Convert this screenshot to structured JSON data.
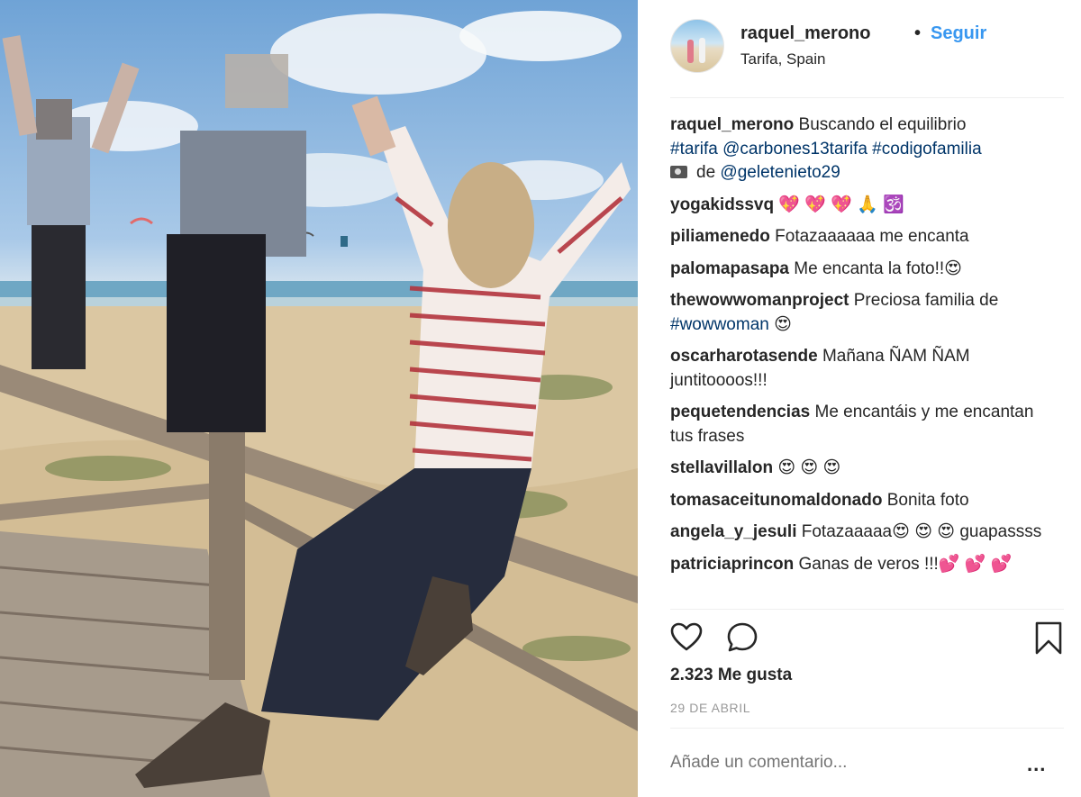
{
  "post": {
    "username": "raquel_merono",
    "separator": "•",
    "follow_label": "Seguir",
    "location": "Tarifa, Spain",
    "caption": {
      "user": "raquel_merono",
      "text_line1": "Buscando el equilibrio",
      "hashtags_line": "#tarifa @carbones13tarifa #codigofamilia",
      "credit_prefix": "de",
      "credit_handle": "@geletenieto29"
    },
    "comments": [
      {
        "user": "yogakidssvq",
        "text": "💖 💖 💖 🙏 🕉️"
      },
      {
        "user": "piliamenedo",
        "text": "Fotazaaaaaa me encanta"
      },
      {
        "user": "palomapasapa",
        "text": "Me encanta la foto!!😍"
      },
      {
        "user": "thewowwomanproject",
        "text": "Preciosa familia de",
        "link": "#wowwoman",
        "tail": " 😍"
      },
      {
        "user": "oscarharotasende",
        "text": "Mañana ÑAM ÑAM juntitoooos!!!"
      },
      {
        "user": "pequetendencias",
        "text": "Me encantáis y me encantan tus frases"
      },
      {
        "user": "stellavillalon",
        "text": "😍 😍 😍"
      },
      {
        "user": "tomasaceitunomaldonado",
        "text": "Bonita foto"
      },
      {
        "user": "angela_y_jesuli",
        "text": "Fotazaaaaa😍 😍 😍 guapassss"
      },
      {
        "user": "patriciaprincon",
        "text": "Ganas de veros !!!💕 💕 💕"
      }
    ],
    "likes_label": "2.323 Me gusta",
    "date_label": "29 DE ABRIL",
    "comment_placeholder": "Añade un comentario...",
    "more_label": "..."
  },
  "icons": {
    "like": "heart-icon",
    "comment": "comment-bubble-icon",
    "save": "bookmark-icon",
    "avatar": "profile-avatar",
    "camera": "camera-emoji-icon"
  },
  "colors": {
    "link": "#003569",
    "follow": "#3897f0",
    "text": "#262626",
    "muted": "#999999"
  }
}
